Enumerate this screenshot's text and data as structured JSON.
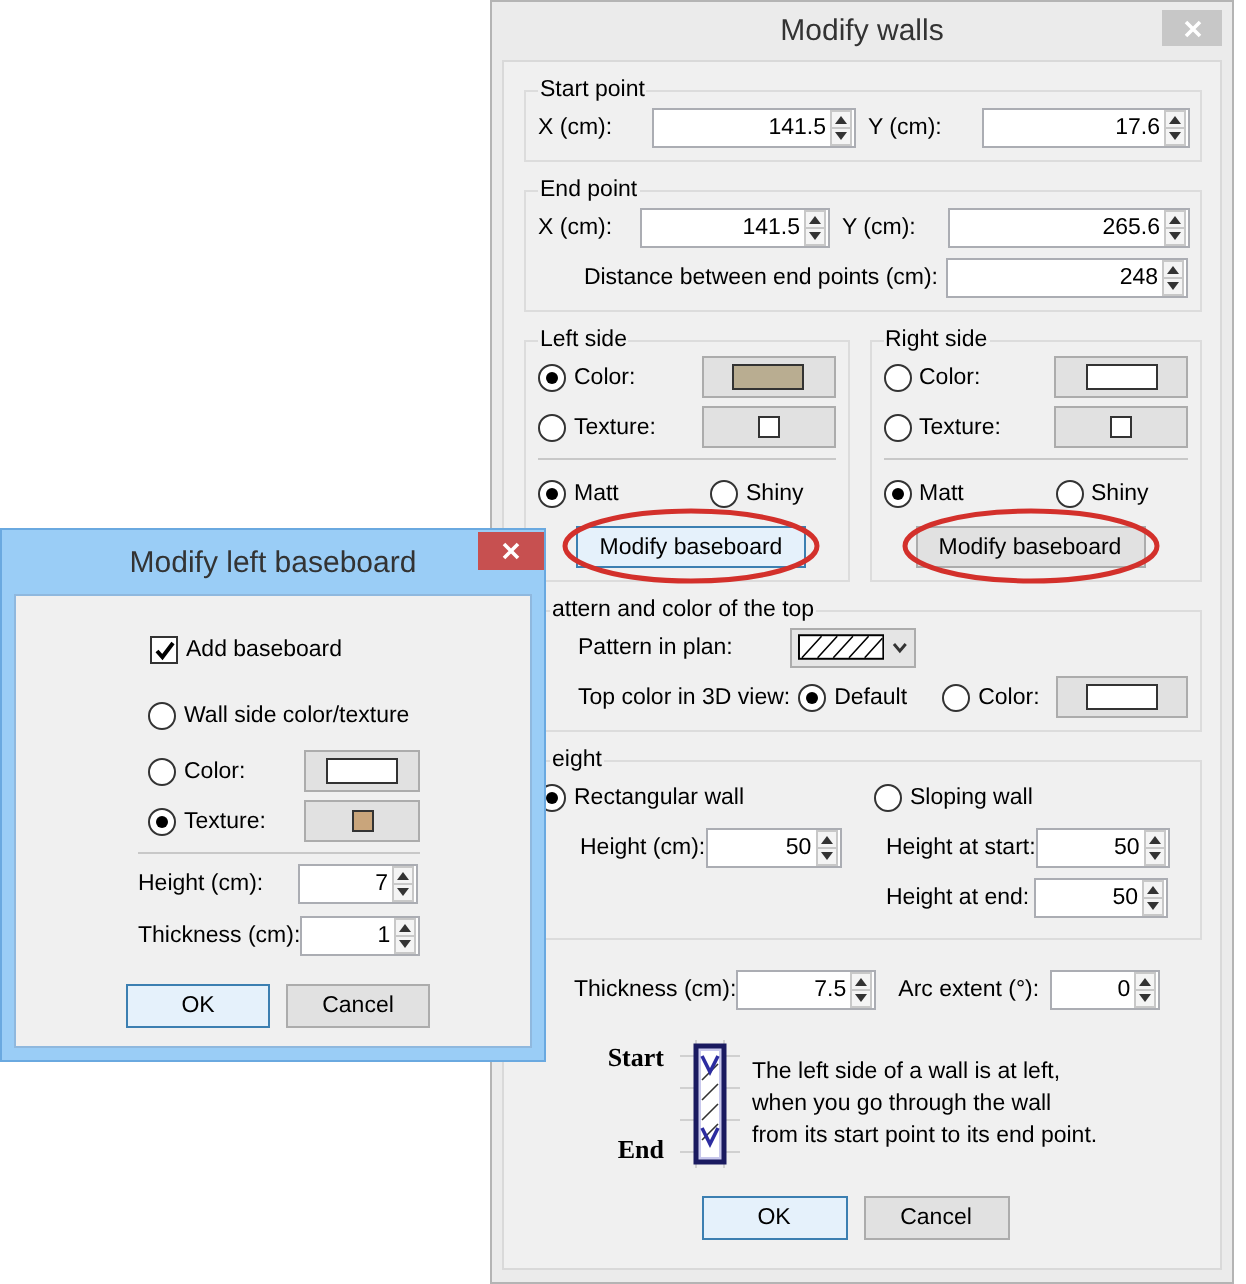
{
  "main_dialog": {
    "title": "Modify walls",
    "start_point": {
      "legend": "Start point",
      "x": {
        "label": "X (cm):",
        "value": "141.5"
      },
      "y": {
        "label": "Y (cm):",
        "value": "17.6"
      }
    },
    "end_point": {
      "legend": "End point",
      "x": {
        "label": "X (cm):",
        "value": "141.5"
      },
      "y": {
        "label": "Y (cm):",
        "value": "265.6"
      },
      "distance": {
        "label": "Distance between end points (cm):",
        "value": "248"
      }
    },
    "sides": [
      {
        "legend": "Left side",
        "options": [
          {
            "kind": "color",
            "label": "Color:",
            "selected": true,
            "color": "#b9ad91"
          },
          {
            "kind": "texture",
            "label": "Texture:",
            "selected": false,
            "color": "#ffffff"
          }
        ],
        "finish": [
          {
            "label": "Matt",
            "selected": true
          },
          {
            "label": "Shiny",
            "selected": false
          }
        ],
        "baseboard_button": {
          "label": "Modify baseboard",
          "focused": true,
          "highlighted": true
        }
      },
      {
        "legend": "Right side",
        "options": [
          {
            "kind": "color",
            "label": "Color:",
            "selected": false,
            "color": "#ffffff"
          },
          {
            "kind": "texture",
            "label": "Texture:",
            "selected": false,
            "color": "#ffffff"
          }
        ],
        "finish": [
          {
            "label": "Matt",
            "selected": true
          },
          {
            "label": "Shiny",
            "selected": false
          }
        ],
        "baseboard_button": {
          "label": "Modify baseboard",
          "focused": false,
          "highlighted": true
        }
      }
    ],
    "top": {
      "legend": "attern and color of the top",
      "pattern": {
        "label": "Pattern in plan:"
      },
      "top_color": {
        "label": "Top color in 3D view:",
        "options": [
          {
            "kind": "plain",
            "label": "Default",
            "selected": true
          },
          {
            "kind": "color",
            "label": "Color:",
            "selected": false,
            "color": "#ffffff"
          }
        ]
      }
    },
    "height": {
      "legend": "eight",
      "shapes": [
        {
          "label": "Rectangular wall",
          "selected": true,
          "fields": [
            {
              "label": "Height (cm):",
              "value": "50"
            }
          ]
        },
        {
          "label": "Sloping wall",
          "selected": false,
          "fields": [
            {
              "label": "Height at start:",
              "value": "50"
            },
            {
              "label": "Height at end:",
              "value": "50"
            }
          ]
        }
      ]
    },
    "thickness": {
      "label": "Thickness (cm):",
      "value": "7.5"
    },
    "arc_extent": {
      "label": "Arc extent (°):",
      "value": "0"
    },
    "illustration": {
      "start": "Start",
      "end": "End",
      "text": "The left side of a wall is at left,\nwhen you go through the wall\nfrom its start point to its end point."
    },
    "buttons": [
      {
        "label": "OK",
        "default": true
      },
      {
        "label": "Cancel",
        "default": false
      }
    ]
  },
  "baseboard_dialog": {
    "title": "Modify left baseboard",
    "add_baseboard": {
      "label": "Add baseboard",
      "checked": true
    },
    "options": [
      {
        "kind": "plain",
        "label": "Wall side color/texture",
        "selected": false
      },
      {
        "kind": "color",
        "label": "Color:",
        "selected": false,
        "color": "#ffffff"
      },
      {
        "kind": "texture",
        "label": "Texture:",
        "selected": true,
        "color": "#c9a57b"
      }
    ],
    "height": {
      "label": "Height (cm):",
      "value": "7"
    },
    "thickness": {
      "label": "Thickness (cm):",
      "value": "1"
    },
    "buttons": [
      {
        "label": "OK",
        "default": true
      },
      {
        "label": "Cancel",
        "default": false
      }
    ]
  }
}
